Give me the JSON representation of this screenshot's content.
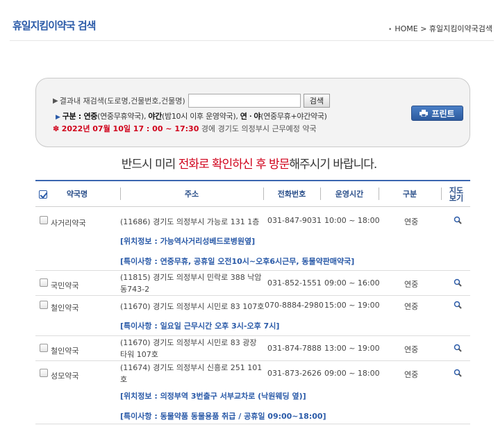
{
  "header": {
    "title": "휴일지킴이약국 검색",
    "breadcrumb": "HOME > 휴일지킴이약국검색"
  },
  "search": {
    "label": "결과내 재검색(도로명,건물번호,건물명)",
    "value": "",
    "button": "검색",
    "legend_key": "구분 : ",
    "legend_a": "연중",
    "legend_a_desc": "(연중무휴약국), ",
    "legend_b": "야간",
    "legend_b_desc": "(밤10시 이후 운영약국), ",
    "legend_c": "연ㆍ야",
    "legend_c_desc": "(연중무휴+야간약국)",
    "date_star": "✽",
    "date_text": "2022년 07월 10일 17 : 00 ~ 17:30",
    "date_suffix": " 경에  경기도  의정부시  근무예정 약국",
    "print_label": "프린트"
  },
  "notice": {
    "pre": "반드시 미리 ",
    "highlight": "전화로 확인하신 후 방문",
    "post": "해주시기 바랍니다."
  },
  "table": {
    "headers": {
      "name": "약국명",
      "address": "주소",
      "phone": "전화번호",
      "hours": "운영시간",
      "type": "구분",
      "map": "지도\n보기"
    },
    "rows": [
      {
        "name": "사거리약국",
        "address": "(11686) 경기도 의정부시 가능로 131 1층",
        "phone": "031-847-9031",
        "hours": "10:00 ~ 18:00",
        "type": "연중",
        "location": "[위치정보 : 가능역사거리성베드로병원옆]",
        "special": "[특이사항 : 연중무휴, 공휴일 오전10시~오후6시근무, 동물약판매약국]"
      },
      {
        "name": "국민약국",
        "address": "(11815) 경기도 의정부시 민락로 388 낙암동743-2",
        "phone": "031-852-1551",
        "hours": "09:00 ~ 16:00",
        "type": "연중"
      },
      {
        "name": "철인약국",
        "address": "(11670) 경기도 의정부시 시민로 83 107호",
        "phone": "070-8884-2980",
        "hours": "15:00 ~ 19:00",
        "type": "연중",
        "special": "[특이사항 : 일요일 근무시간 오후 3시-오후 7시]"
      },
      {
        "name": "철인약국",
        "address": "(11670) 경기도 의정부시 시민로 83 광장타워 107호",
        "phone": "031-874-7888",
        "hours": "13:00 ~ 19:00",
        "type": "연중"
      },
      {
        "name": "성모약국",
        "address": "(11674) 경기도 의정부시 신흥로 251 101호",
        "phone": "031-873-2626",
        "hours": "09:00 ~ 18:00",
        "type": "연중",
        "location": "[위치정보 : 의정부역 3번출구 서부교차로 (낙원웨딩 옆)]",
        "special": "[특이사항 : 동물약품 동물용품 취급 / 공휴일 09:00~18:00]"
      }
    ]
  },
  "colors": {
    "brand": "#2a5aa8",
    "highlight": "#d0021b"
  }
}
